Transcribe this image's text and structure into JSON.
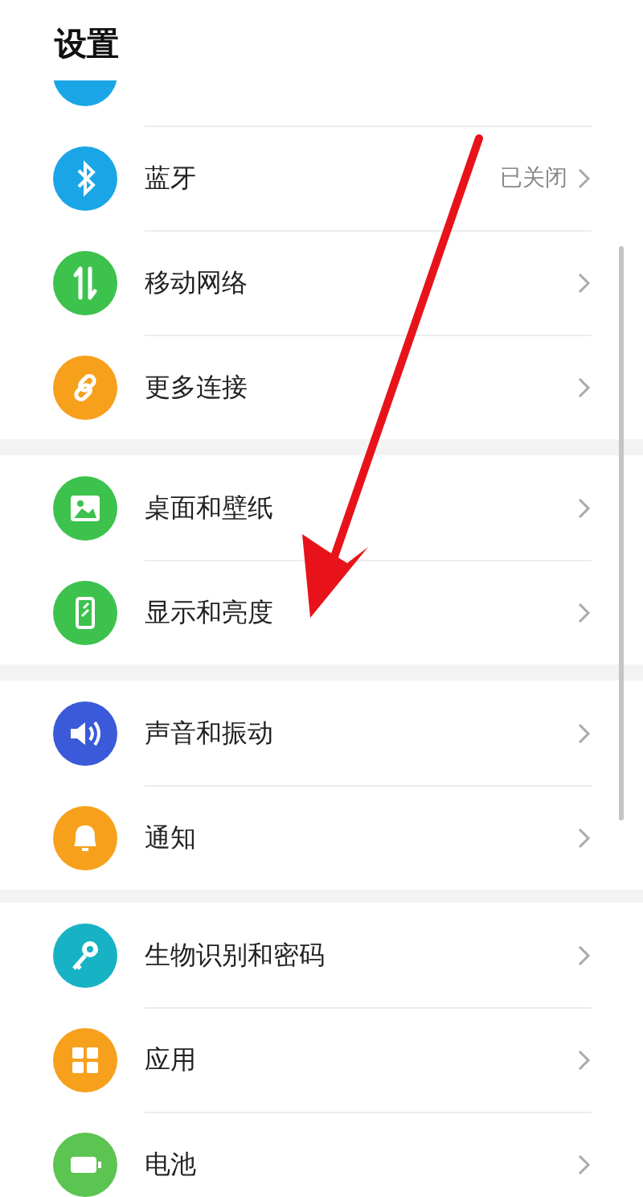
{
  "title": "设置",
  "sections": [
    {
      "items": [
        {
          "kind": "partial",
          "color": "#1aa6e6"
        },
        {
          "kind": "row",
          "label": "蓝牙",
          "value": "已关闭",
          "color": "#1aa6e6"
        },
        {
          "kind": "row",
          "label": "移动网络",
          "color": "#3cc24d"
        },
        {
          "kind": "row",
          "label": "更多连接",
          "color": "#f7a01c"
        }
      ]
    },
    {
      "items": [
        {
          "kind": "row",
          "label": "桌面和壁纸",
          "color": "#3cc24d"
        },
        {
          "kind": "row",
          "label": "显示和亮度",
          "color": "#3cc24d"
        }
      ]
    },
    {
      "items": [
        {
          "kind": "row",
          "label": "声音和振动",
          "color": "#3a5ad9"
        },
        {
          "kind": "row",
          "label": "通知",
          "color": "#f7a01c"
        }
      ]
    },
    {
      "items": [
        {
          "kind": "row",
          "label": "生物识别和密码",
          "color": "#17b3c4"
        },
        {
          "kind": "row",
          "label": "应用",
          "color": "#f7a01c"
        },
        {
          "kind": "row",
          "label": "电池",
          "color": "#5cc451"
        }
      ]
    }
  ],
  "annotation": {
    "kind": "arrow"
  }
}
